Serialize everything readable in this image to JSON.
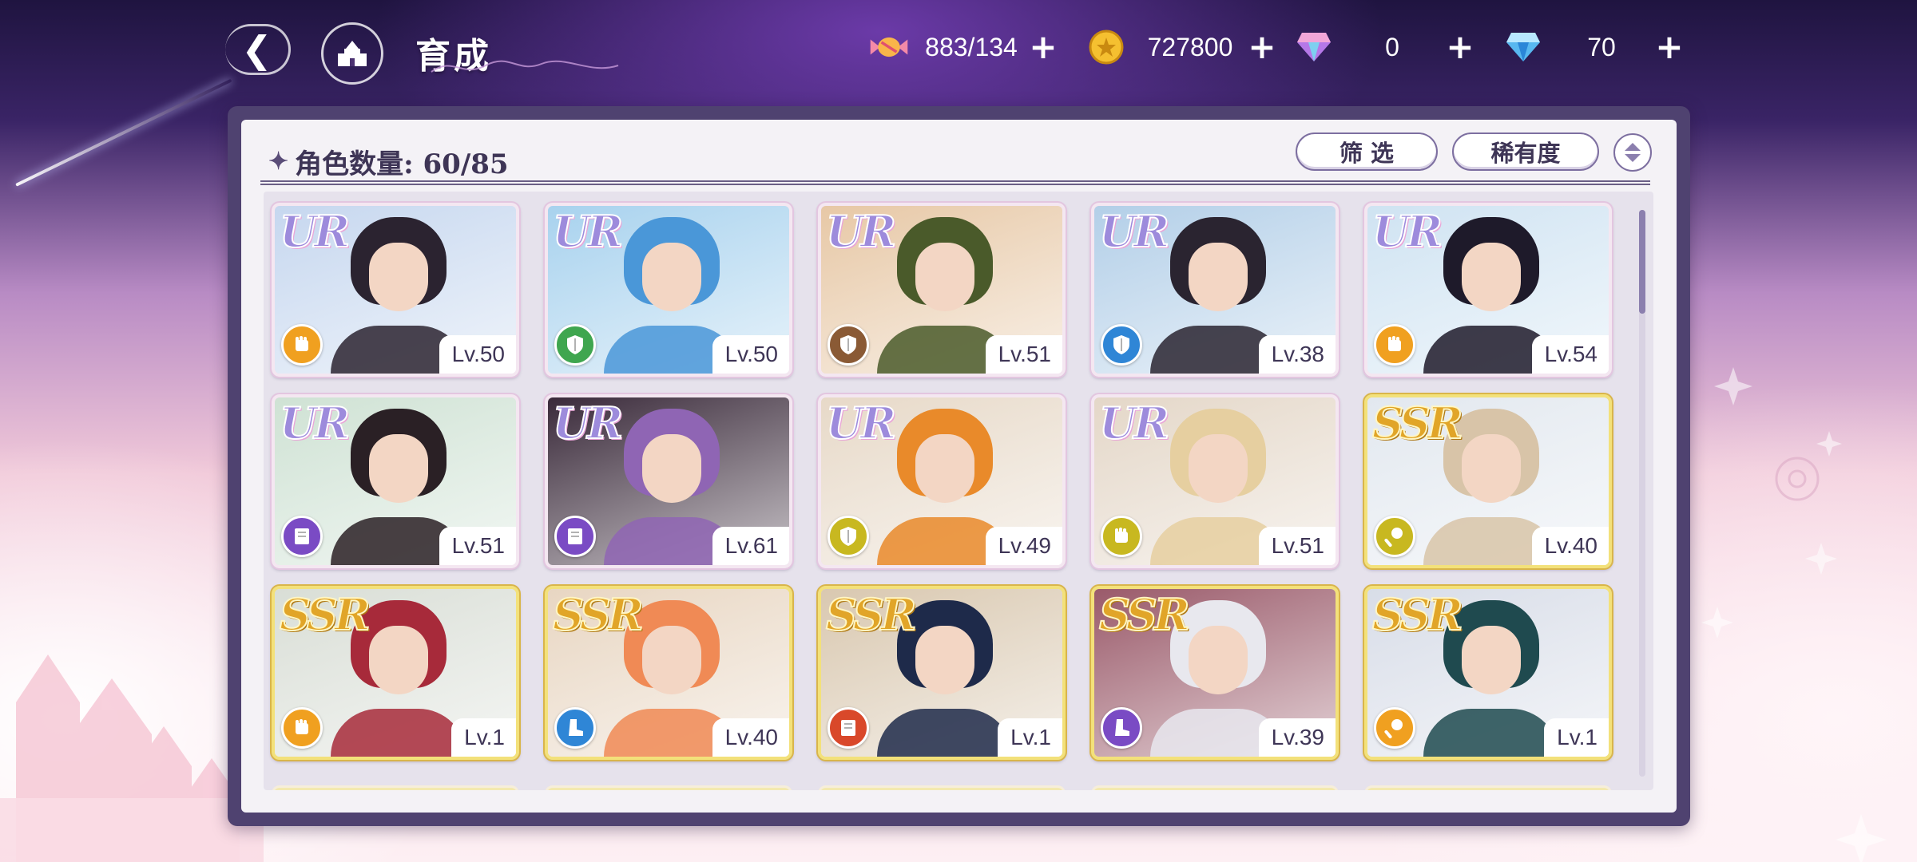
{
  "topbar": {
    "title": "育成",
    "resources": [
      {
        "icon": "candy-icon",
        "value": "883/134"
      },
      {
        "icon": "gold-coin-icon",
        "value": "727800"
      },
      {
        "icon": "pink-diamond-icon",
        "value": "0"
      },
      {
        "icon": "blue-diamond-icon",
        "value": "70"
      }
    ],
    "plus": "+"
  },
  "panel": {
    "count_label": "角色数量: 60/85",
    "filter_label": "筛 选",
    "rarity_label": "稀有度"
  },
  "colors": {
    "accent": "#4f4270",
    "class_orange": "#f0a020",
    "class_green": "#3fa64f",
    "class_brown": "#8a5a35",
    "class_blue": "#2f86d6",
    "class_purple": "#7a4bc4",
    "class_yellow": "#c8b820",
    "class_red": "#d9482a"
  },
  "cards": [
    {
      "rarity": "UR",
      "level": "Lv.50",
      "class_icon": "fist-icon",
      "class_color": "#f0a020",
      "hair": "#2b2330",
      "bg": "#c6d7ef"
    },
    {
      "rarity": "UR",
      "level": "Lv.50",
      "class_icon": "shield-icon",
      "class_color": "#3fa64f",
      "hair": "#4a97d8",
      "bg": "#a8d2ee"
    },
    {
      "rarity": "UR",
      "level": "Lv.51",
      "class_icon": "shield-icon",
      "class_color": "#8a5a35",
      "hair": "#4a5a2a",
      "bg": "#e7c8a6"
    },
    {
      "rarity": "UR",
      "level": "Lv.38",
      "class_icon": "shield-icon",
      "class_color": "#2f86d6",
      "hair": "#2a2430",
      "bg": "#b3cfe8"
    },
    {
      "rarity": "UR",
      "level": "Lv.54",
      "class_icon": "fist-icon",
      "class_color": "#f0a020",
      "hair": "#1e1a2a",
      "bg": "#cfe3f2"
    },
    {
      "rarity": "UR",
      "level": "Lv.51",
      "class_icon": "book-icon",
      "class_color": "#7a4bc4",
      "hair": "#2a2025",
      "bg": "#cfe2d4"
    },
    {
      "rarity": "UR",
      "level": "Lv.61",
      "class_icon": "book-icon",
      "class_color": "#7a4bc4",
      "hair": "#8f65b4",
      "bg": "#3a2a3a"
    },
    {
      "rarity": "UR",
      "level": "Lv.49",
      "class_icon": "shield-icon",
      "class_color": "#c8b820",
      "hair": "#e98a2a",
      "bg": "#e7d9c8"
    },
    {
      "rarity": "UR",
      "level": "Lv.51",
      "class_icon": "fist-icon",
      "class_color": "#c8b820",
      "hair": "#e6cfa0",
      "bg": "#e4d7c8"
    },
    {
      "rarity": "SSR",
      "level": "Lv.40",
      "class_icon": "wand-icon",
      "class_color": "#c8b820",
      "hair": "#d8c4a8",
      "bg": "#e2e8ef"
    },
    {
      "rarity": "SSR",
      "level": "Lv.1",
      "class_icon": "fist-icon",
      "class_color": "#f0a020",
      "hair": "#a72a3a",
      "bg": "#d9ded6"
    },
    {
      "rarity": "SSR",
      "level": "Lv.40",
      "class_icon": "boot-icon",
      "class_color": "#2f86d6",
      "hair": "#f08a55",
      "bg": "#e8d6c2"
    },
    {
      "rarity": "SSR",
      "level": "Lv.1",
      "class_icon": "book-icon",
      "class_color": "#d9482a",
      "hair": "#1e2a4a",
      "bg": "#d9c8b0"
    },
    {
      "rarity": "SSR",
      "level": "Lv.39",
      "class_icon": "boot-icon",
      "class_color": "#7a4bc4",
      "hair": "#e8e8ee",
      "bg": "#9a5a6a"
    },
    {
      "rarity": "SSR",
      "level": "Lv.1",
      "class_icon": "wand-icon",
      "class_color": "#f0a020",
      "hair": "#1f4a4f",
      "bg": "#d8dde8"
    }
  ]
}
